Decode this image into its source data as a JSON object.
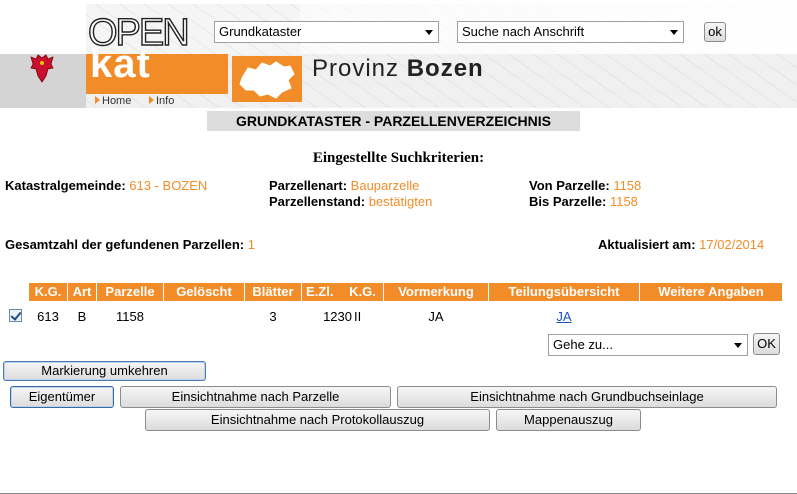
{
  "header": {
    "logo_open": "OPEN",
    "logo_kat": "kat",
    "brand_provinz": "Provinz",
    "brand_bozen": "Bozen",
    "nav": {
      "home": "Home",
      "info": "Info"
    },
    "select_kataster": "Grundkataster",
    "select_suche": "Suche nach Anschrift",
    "ok_label": "ok"
  },
  "page_title": "GRUNDKATASTER - PARZELLENVERZEICHNIS",
  "criteria": {
    "title": "Eingestellte Suchkriterien:",
    "katastralgemeinde_label": "Katastralgemeinde:",
    "katastralgemeinde_value": "613 - BOZEN",
    "parzellenart_label": "Parzellenart:",
    "parzellenart_value": "Bauparzelle",
    "parzellenstand_label": "Parzellenstand:",
    "parzellenstand_value": "bestätigten",
    "von_parzelle_label": "Von Parzelle:",
    "von_parzelle_value": "1158",
    "bis_parzelle_label": "Bis Parzelle:",
    "bis_parzelle_value": "1158"
  },
  "summary": {
    "total_label": "Gesamtzahl der gefundenen Parzellen:",
    "total_value": "1",
    "updated_label": "Aktualisiert am:",
    "updated_value": "17/02/2014"
  },
  "table": {
    "headers": [
      "K.G.",
      "Art",
      "Parzelle",
      "Gelöscht",
      "Blätter",
      "E.Zl.",
      "K.G.",
      "Vormerkung",
      "Teilungsübersicht",
      "Weitere Angaben"
    ],
    "rows": [
      {
        "checked": true,
        "kg": "613",
        "art": "B",
        "parzelle": "1158",
        "geloescht": "",
        "blaetter": "3",
        "ezl": "1230",
        "kg2": "II",
        "vormerkung": "JA",
        "teilung": "JA",
        "weitere": ""
      }
    ]
  },
  "actions": {
    "gehe_zu": "Gehe zu...",
    "ok_label": "OK",
    "markierung": "Markierung umkehren",
    "eigentuemer": "Eigentümer",
    "einsicht_parzelle": "Einsichtnahme nach Parzelle",
    "einsicht_grundbuch": "Einsichtnahme nach Grundbuchseinlage",
    "einsicht_protokoll": "Einsichtnahme nach Protokollauszug",
    "mappenauszug": "Mappenauszug"
  },
  "colors": {
    "accent": "#f28c28",
    "link": "#1a4fc6",
    "title_bg": "#dddddd"
  }
}
